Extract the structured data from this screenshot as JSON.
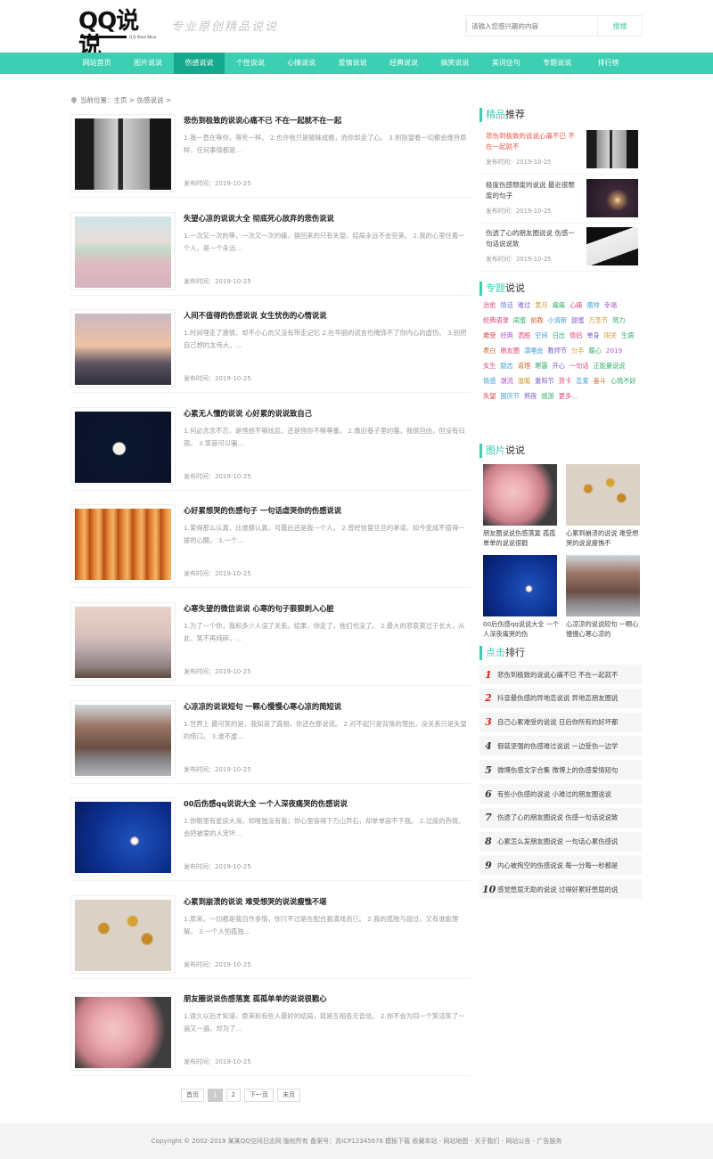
{
  "header": {
    "logo_text": "QQ说说",
    "logo_sub": "Q Q Shuo Shuo",
    "slogan": "专业原创精品说说",
    "search_placeholder": "请输入您感兴趣的内容",
    "search_button": "搜搜"
  },
  "nav": {
    "items": [
      {
        "label": "网站首页",
        "active": false
      },
      {
        "label": "图片说说",
        "active": false
      },
      {
        "label": "伤感说说",
        "active": true
      },
      {
        "label": "个性说说",
        "active": false
      },
      {
        "label": "心情说说",
        "active": false
      },
      {
        "label": "爱情说说",
        "active": false
      },
      {
        "label": "经典说说",
        "active": false
      },
      {
        "label": "搞笑说说",
        "active": false
      },
      {
        "label": "美词佳句",
        "active": false
      },
      {
        "label": "专题说说",
        "active": false
      },
      {
        "label": "排行榜",
        "active": false
      }
    ]
  },
  "breadcrumb": "当前位置：主页 > 伤感说说 >",
  "articles": [
    {
      "title": "悲伤到极致的说说心痛不已 不在一起就不在一起",
      "summary": "1.我一直在等你，等死一样。 2.也许他只是随昧成瘾，而你却走了心。 3.别指望看一切都会维持原样，任何事情都是...",
      "date": "发布时间：2019-10-25",
      "image": "woman-window"
    },
    {
      "title": "失望心凉的说说大全 彻底死心放弃的悲伤说说",
      "summary": "1.一次又一次的等，一次又一次的痛，换回来的只有失望，结局永远不会完美。 2.我的心里住着一个人，是一个永远...",
      "date": "发布时间：2019-10-25",
      "image": "girl-field"
    },
    {
      "title": "人间不值得的伤感说说 女生忧伤的心情说说",
      "summary": "1.时间埋走了激情，却不小心的又没有带走记忆 2.在华丽的谎言也掩饰不了你内心的虚伪。 3.别把自己想的太伟大，...",
      "date": "发布时间：2019-10-25",
      "image": "woman-sunset"
    },
    {
      "title": "心累无人懂的说说 心好累的说说致自己",
      "summary": "1.何必念念不忘，是怪他不够炫忍，还是怪你不够尊重。 2.像旧巷子里的猫，我很自由，但没有归宿。 3.笑容可以骗...",
      "date": "发布时间：2019-10-25",
      "image": "moon"
    },
    {
      "title": "心好累想哭的伤感句子 一句话虐哭你的伤感说说",
      "summary": "1.爱得那么认真，比谁都认真，可最后还是我一个人。 2.曾经信誓旦旦的承诺，如今变成不值得一提的心酸。 3.一个...",
      "date": "发布时间：2019-10-25",
      "image": "curtains"
    },
    {
      "title": "心寒失望的微信说说 心寒的句子狠狠刺入心脏",
      "summary": "1.为了一个你，我和多少人误了关系。结果，你走了，他们也没了。 2.最大的悲哀莫过于长大，从此，笑不再纯碎，...",
      "date": "发布时间：2019-10-25",
      "image": "girl-seaside"
    },
    {
      "title": "心凉凉的说说短句 一颗心慢慢心寒心凉的简短说",
      "summary": "1.世界上 最可笑的是，我知道了真相，你还在那说谎。 2.对不起只是背叛的理由，没关系只是失望的借口。 3.谁不虚...",
      "date": "发布时间：2019-10-25",
      "image": "street"
    },
    {
      "title": "00后伤感qq说说大全 一个人深夜痛哭的伤感说说",
      "summary": "1.你眼里有星辰大海，却唯独没有我；你心里容得下万山异石，却单单容不下我。 2.过度的热情，会把被爱的人宠坏...",
      "date": "发布时间：2019-10-25",
      "image": "flower-water"
    },
    {
      "title": "心累到崩溃的说说 难受想哭的说说瘦憔不堪",
      "summary": "1.原来，一切都是我自作多情，你只不过是在配合我演戏而已。 2.我的孤独与寂过，又有谁能理解。 3.一个人怕孤独...",
      "date": "发布时间：2019-10-25",
      "image": "dried-flowers"
    },
    {
      "title": "朋友圈说说伤感落寞 孤孤单单的说说很戳心",
      "summary": "1.很久以后才知道，原来和有些人最好的结局，就是互相各无音信。 2.你不会为同一个笑话笑了一遍又一遍，却为了...",
      "date": "发布时间：2019-10-25",
      "image": "carnations"
    }
  ],
  "pager": [
    "首页",
    "1",
    "2",
    "下一页",
    "末页"
  ],
  "featured": {
    "title_hl": "精品",
    "title_rest": "推荐",
    "items": [
      {
        "title": "悲伤到极致的说说心痛不已 不在一起就不",
        "date": "发布时间：2019-10-25",
        "red": true,
        "image": "woman-window"
      },
      {
        "title": "极度伤感颓废的说说 最近很颓废的句子",
        "date": "发布时间：2019-10-25",
        "red": false,
        "image": "candle"
      },
      {
        "title": "伤透了心的朋友圈说说 伤感一句话说说致",
        "date": "发布时间：2019-10-25",
        "red": false,
        "image": "phone"
      }
    ]
  },
  "topics": {
    "title_hl": "专题",
    "title_rest": "说说",
    "tags": [
      {
        "label": "治愈",
        "color": "#e0457b"
      },
      {
        "label": "情话",
        "color": "#6b7cdf"
      },
      {
        "label": "难过",
        "color": "#7a57d1"
      },
      {
        "label": "黄月",
        "color": "#cf9a2e"
      },
      {
        "label": "痛痛",
        "color": "#2fae6a"
      },
      {
        "label": "心痛",
        "color": "#e0457b"
      },
      {
        "label": "痞帅",
        "color": "#3a9ed8"
      },
      {
        "label": "幸福",
        "color": "#b05ad1"
      },
      {
        "label": "经典语录",
        "color": "#e0457b"
      },
      {
        "label": "闺蜜",
        "color": "#2fae6a"
      },
      {
        "label": "前教",
        "color": "#cf6a2e"
      },
      {
        "label": "小清新",
        "color": "#3a9ed8"
      },
      {
        "label": "甜蜜",
        "color": "#7a57d1"
      },
      {
        "label": "万圣节",
        "color": "#cf9a2e"
      },
      {
        "label": "努力",
        "color": "#2fae6a"
      },
      {
        "label": "难受",
        "color": "#e04545"
      },
      {
        "label": "经典",
        "color": "#b05ad1"
      },
      {
        "label": "洒脱",
        "color": "#e0457b"
      },
      {
        "label": "空间",
        "color": "#3a9ed8"
      },
      {
        "label": "日出",
        "color": "#2fae6a"
      },
      {
        "label": "情侣",
        "color": "#e0457b"
      },
      {
        "label": "单身",
        "color": "#7a57d1"
      },
      {
        "label": "阳关",
        "color": "#cf9a2e"
      },
      {
        "label": "生病",
        "color": "#2fae6a"
      },
      {
        "label": "表白",
        "color": "#cf6a2e"
      },
      {
        "label": "朋友圈",
        "color": "#e0457b"
      },
      {
        "label": "演唱会",
        "color": "#3a9ed8"
      },
      {
        "label": "教师节",
        "color": "#7a57d1"
      },
      {
        "label": "分手",
        "color": "#cf9a2e"
      },
      {
        "label": "暖心",
        "color": "#2fae6a"
      },
      {
        "label": "2019",
        "color": "#b05ad1"
      },
      {
        "label": "女生",
        "color": "#e0457b"
      },
      {
        "label": "励志",
        "color": "#3a9ed8"
      },
      {
        "label": "道理",
        "color": "#cf6a2e"
      },
      {
        "label": "寒露",
        "color": "#2fae6a"
      },
      {
        "label": "开心",
        "color": "#7a57d1"
      },
      {
        "label": "一句话",
        "color": "#e0457b"
      },
      {
        "label": "正能量说说",
        "color": "#2fae6a"
      },
      {
        "label": "情感",
        "color": "#3a9ed8"
      },
      {
        "label": "潮流",
        "color": "#b05ad1"
      },
      {
        "label": "温暖",
        "color": "#cf9a2e"
      },
      {
        "label": "重阳节",
        "color": "#7a57d1"
      },
      {
        "label": "贺卡",
        "color": "#e0457b"
      },
      {
        "label": "恋爱",
        "color": "#3a9ed8"
      },
      {
        "label": "奋斗",
        "color": "#cf6a2e"
      },
      {
        "label": "心情不好",
        "color": "#2fae6a"
      },
      {
        "label": "失望",
        "color": "#e04545"
      },
      {
        "label": "国庆节",
        "color": "#3a9ed8"
      },
      {
        "label": "熬夜",
        "color": "#7a57d1"
      },
      {
        "label": "旅游",
        "color": "#2fae6a"
      },
      {
        "label": "更多...",
        "color": "#e0457b"
      }
    ]
  },
  "pictures": {
    "title_hl": "图片",
    "title_rest": "说说",
    "items": [
      {
        "caption": "朋友圈说说伤感落寞 孤孤单单的说说很戳",
        "image": "carnations"
      },
      {
        "caption": "心累到崩溃的说说 难受想哭的说说瘦憔不",
        "image": "dried-flowers"
      },
      {
        "caption": "00后伤感qq说说大全 一个人深夜痛哭的伤",
        "image": "flower-water"
      },
      {
        "caption": "心凉凉的说说短句 一颗心慢慢心寒心凉的",
        "image": "street"
      }
    ]
  },
  "ranking": {
    "title_hl": "点击",
    "title_rest": "排行",
    "items": [
      {
        "num": "1",
        "text": "悲伤到极致的说说心痛不已 不在一起就不"
      },
      {
        "num": "2",
        "text": "抖音最伤感的异地恋说说 异地恋朋友圈说"
      },
      {
        "num": "3",
        "text": "自己心累难受的说说 日后你所有的好坏都"
      },
      {
        "num": "4",
        "text": "假装坚强的伤感难过说说 一边受伤一边学"
      },
      {
        "num": "5",
        "text": "微博伤感文字合集 微博上的伤感爱情短句"
      },
      {
        "num": "6",
        "text": "有些小伤感的说说 小难过的朋友圈说说"
      },
      {
        "num": "7",
        "text": "伤透了心的朋友圈说说 伤感一句话说说致"
      },
      {
        "num": "8",
        "text": "心累怎么发朋友圈说说 一句话心累伤感说"
      },
      {
        "num": "9",
        "text": "内心被掏空的伤感说说 每一分每一秒都是"
      },
      {
        "num": "10",
        "text": "感觉憋屈无助的说说 过得好累好憋屈的说"
      }
    ]
  },
  "footer": "Copyright © 2002-2019 某某QQ空间日志网 版权所有 备案号：苏ICP12345678    模板下载    收藏本站 - 网站地图 - 关于我们 - 网站公告 - 广告服务"
}
